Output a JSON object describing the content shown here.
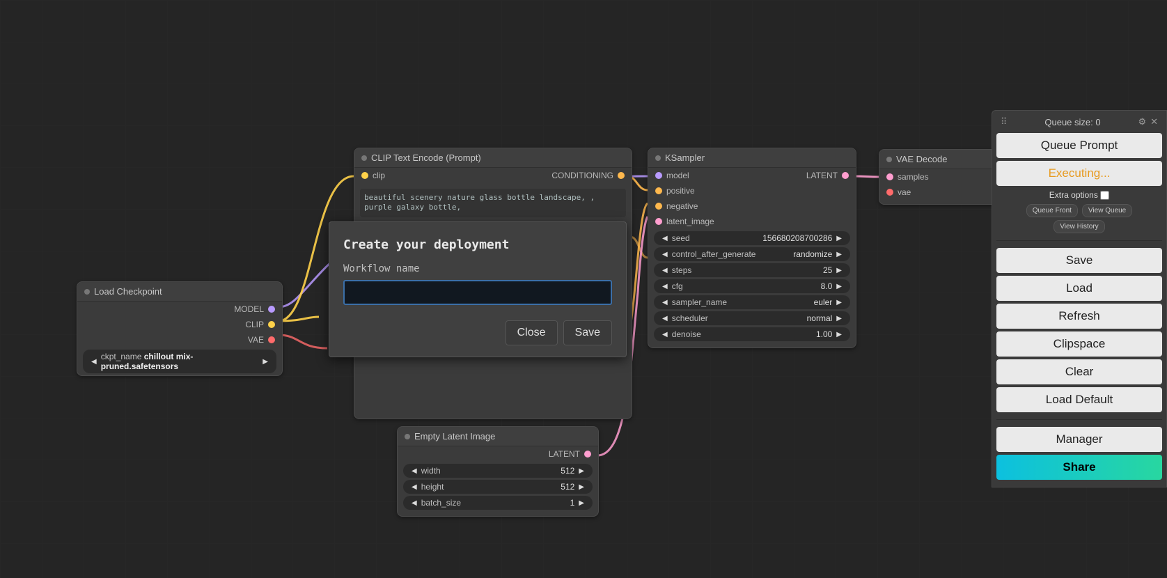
{
  "nodes": {
    "load_checkpoint": {
      "title": "Load Checkpoint",
      "outputs": {
        "model": "MODEL",
        "clip": "CLIP",
        "vae": "VAE"
      },
      "ckpt_label": "ckpt_name",
      "ckpt_value": "chillout mix-pruned.safetensors"
    },
    "clip_encode": {
      "title": "CLIP Text Encode (Prompt)",
      "input_clip": "clip",
      "output_cond": "CONDITIONING",
      "text": "beautiful scenery nature glass bottle landscape, , purple galaxy bottle,"
    },
    "ksampler": {
      "title": "KSampler",
      "inputs": {
        "model": "model",
        "positive": "positive",
        "negative": "negative",
        "latent_image": "latent_image"
      },
      "output_latent": "LATENT",
      "params": [
        {
          "label": "seed",
          "value": "156680208700286"
        },
        {
          "label": "control_after_generate",
          "value": "randomize"
        },
        {
          "label": "steps",
          "value": "25"
        },
        {
          "label": "cfg",
          "value": "8.0"
        },
        {
          "label": "sampler_name",
          "value": "euler"
        },
        {
          "label": "scheduler",
          "value": "normal"
        },
        {
          "label": "denoise",
          "value": "1.00"
        }
      ]
    },
    "vae_decode": {
      "title": "VAE Decode",
      "inputs": {
        "samples": "samples",
        "vae": "vae"
      }
    },
    "empty_latent": {
      "title": "Empty Latent Image",
      "output_latent": "LATENT",
      "params": [
        {
          "label": "width",
          "value": "512"
        },
        {
          "label": "height",
          "value": "512"
        },
        {
          "label": "batch_size",
          "value": "1"
        }
      ]
    }
  },
  "modal": {
    "title": "Create your deployment",
    "label": "Workflow name",
    "input_value": "",
    "close": "Close",
    "save": "Save"
  },
  "panel": {
    "queue_size_label": "Queue size: 0",
    "queue_prompt": "Queue Prompt",
    "executing": "Executing...",
    "extra_options": "Extra options",
    "queue_front": "Queue Front",
    "view_queue": "View Queue",
    "view_history": "View History",
    "save": "Save",
    "load": "Load",
    "refresh": "Refresh",
    "clipspace": "Clipspace",
    "clear": "Clear",
    "load_default": "Load Default",
    "manager": "Manager",
    "share": "Share"
  }
}
